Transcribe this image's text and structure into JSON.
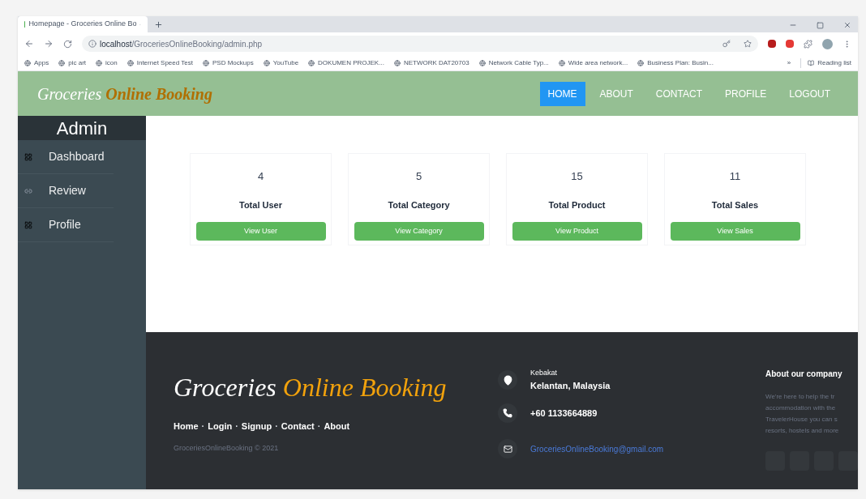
{
  "browser": {
    "tab_title": "Homepage - Groceries Online Bo",
    "url_host": "localhost",
    "url_path": "/GroceriesOnlineBooking/admin.php",
    "bookmarks": [
      "Apps",
      "pic art",
      "icon",
      "Internet Speed Test",
      "PSD Mockups",
      "YouTube",
      "DOKUMEN PROJEK...",
      "NETWORK DAT20703",
      "Network Cable Typ...",
      "Wide area network...",
      "Business Plan: Busin..."
    ],
    "overflow": "»",
    "reading_list": "Reading list"
  },
  "header": {
    "logo": {
      "first": "Groceries",
      "second": "Online Booking"
    },
    "nav": [
      {
        "label": "HOME",
        "selected": true
      },
      {
        "label": "ABOUT",
        "selected": false
      },
      {
        "label": "CONTACT",
        "selected": false
      },
      {
        "label": "PROFILE",
        "selected": false
      },
      {
        "label": "LOGOUT",
        "selected": false
      }
    ]
  },
  "sidebar": {
    "title": "Admin",
    "items": [
      {
        "label": "Dashboard",
        "kind": "grid"
      },
      {
        "label": "Review",
        "kind": "link"
      },
      {
        "label": "Profile",
        "kind": "grid"
      }
    ]
  },
  "cards": [
    {
      "count": "4",
      "title": "Total User",
      "button": "View User"
    },
    {
      "count": "5",
      "title": "Total Category",
      "button": "View Category"
    },
    {
      "count": "15",
      "title": "Total Product",
      "button": "View Product"
    },
    {
      "count": "11",
      "title": "Total Sales",
      "button": "View Sales"
    }
  ],
  "footer": {
    "logo": {
      "first": "Groceries",
      "second": "Online Booking"
    },
    "links": [
      "Home",
      "Login",
      "Signup",
      "Contact",
      "About"
    ],
    "link_separator": "·",
    "copyright": "GroceriesOnlineBooking © 2021",
    "address_line1": "Kebakat",
    "address_line2": "Kelantan, Malaysia",
    "phone": "+60 1133664889",
    "email": "GroceriesOnlineBooking@gmail.com",
    "about_title": "About our company",
    "about_lines": [
      "We're here to help the tr",
      "accommodation with the",
      "TravelerHouse you can s",
      "resorts, hostels and more"
    ]
  }
}
